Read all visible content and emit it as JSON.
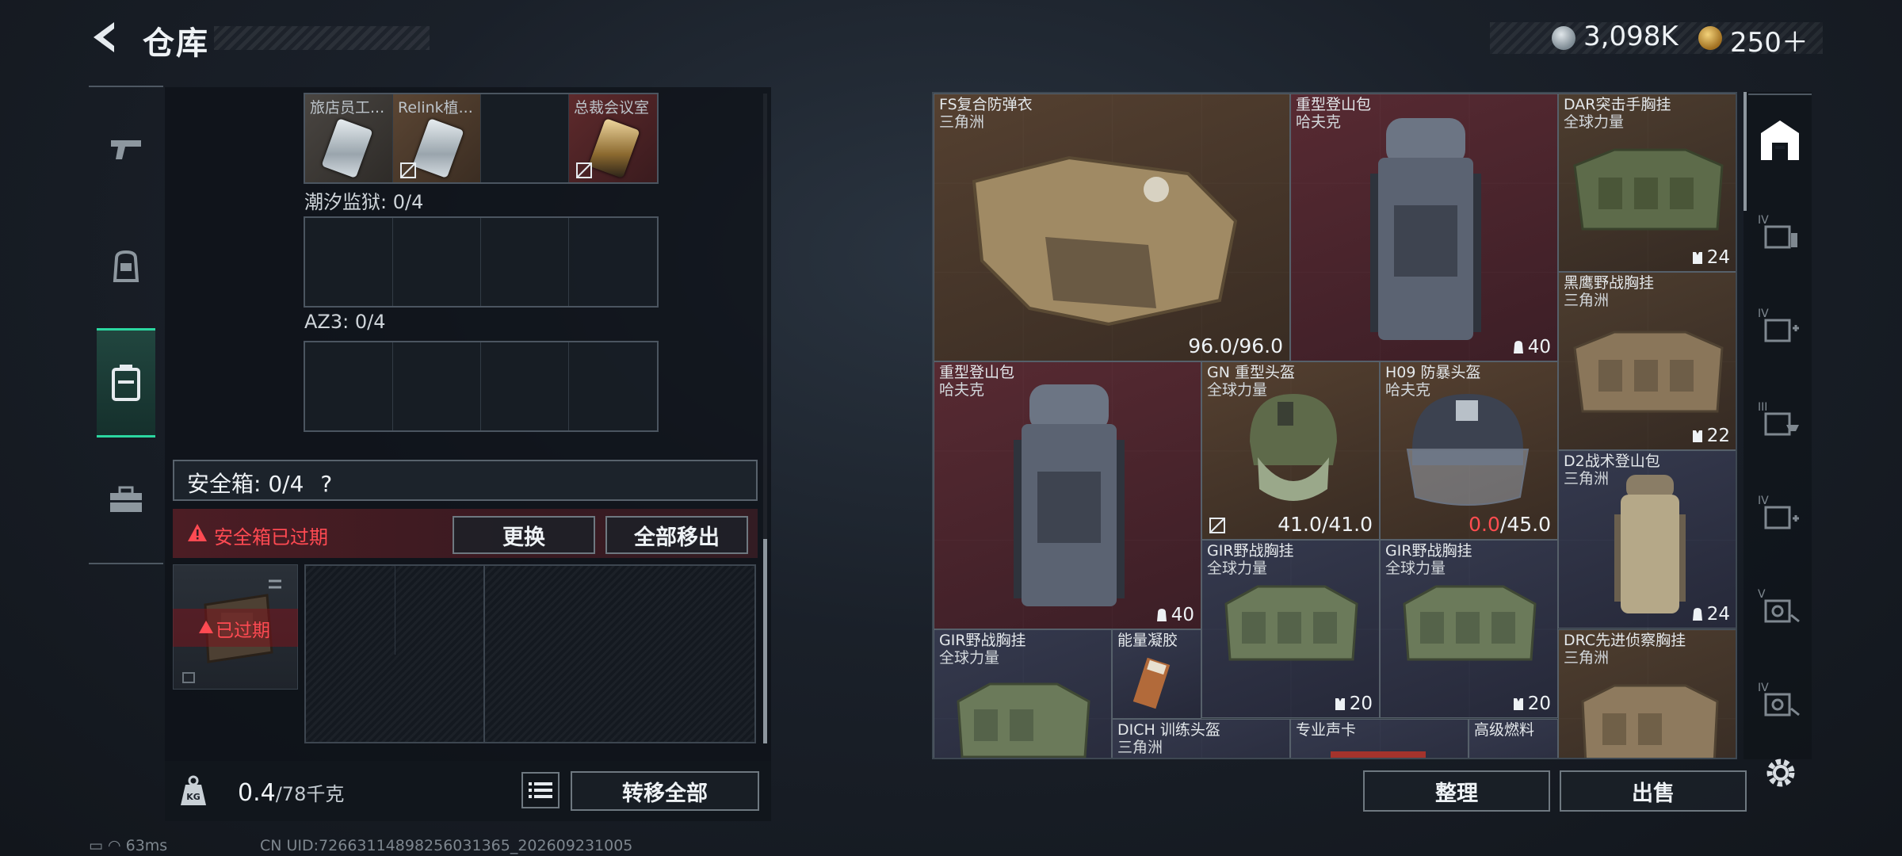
{
  "header": {
    "title": "仓库"
  },
  "currency": {
    "silver": "3,098K",
    "gold": "250＋"
  },
  "nav": [
    "weapon-tab",
    "gear-tab",
    "container-tab",
    "case-tab"
  ],
  "keys_row": [
    {
      "label": "旅店员工...",
      "style": "silver",
      "locked": false
    },
    {
      "label": "Relink植...",
      "style": "silver",
      "locked": true
    },
    {
      "label": "",
      "style": "empty",
      "locked": false
    },
    {
      "label": "总裁会议室",
      "style": "gold",
      "locked": true
    }
  ],
  "sections": [
    {
      "label": "潮汐监狱: 0/4"
    },
    {
      "label": "AZ3: 0/4"
    }
  ],
  "safebox": {
    "label": "安全箱:  0/4",
    "help": "?",
    "warning": "安全箱已过期",
    "swap_btn": "更换",
    "moveall_btn": "全部移出",
    "expired": "已过期"
  },
  "weight": {
    "value": "0.4",
    "unit": "/78千克",
    "transfer_btn": "转移全部"
  },
  "status": {
    "ping": "63ms",
    "uid": "CN UID:7266311489825603136​5_202609231005"
  },
  "stash_items": [
    {
      "name": "FS复合防弹衣",
      "sub": "三角洲",
      "dur": "96.0/96.0",
      "dur_red": ""
    },
    {
      "name": "重型登山包",
      "sub": "哈夫克",
      "count": "40"
    },
    {
      "name": "DAR突击手胸挂",
      "sub": "全球力量",
      "count": "24"
    },
    {
      "name": "黑鹰野战胸挂",
      "sub": "三角洲",
      "count": "22"
    },
    {
      "name": "重型登山包",
      "sub": "哈夫克",
      "count": "40"
    },
    {
      "name": "GN 重型头盔",
      "sub": "全球力量",
      "dur": "41.0/41.0",
      "dur_red": ""
    },
    {
      "name": "H09 防暴头盔",
      "sub": "哈夫克",
      "dur": "/45.0",
      "dur_red": "0.0"
    },
    {
      "name": "D2战术登山包",
      "sub": "三角洲",
      "count": "24"
    },
    {
      "name": "GIR野战胸挂",
      "sub": "全球力量",
      "count": "20"
    },
    {
      "name": "GIR野战胸挂",
      "sub": "全球力量",
      "count": "20"
    },
    {
      "name": "GIR野战胸挂",
      "sub": "全球力量"
    },
    {
      "name": "能量凝胶",
      "sub": ""
    },
    {
      "name": "DRC先进侦察胸挂",
      "sub": "三角洲"
    },
    {
      "name": "DICH 训练头盔",
      "sub": "三角洲"
    },
    {
      "name": "专业声卡",
      "sub": ""
    },
    {
      "name": "高级燃料",
      "sub": ""
    }
  ],
  "stash_buttons": {
    "sort": "整理",
    "sell": "出售"
  },
  "right_tabs": [
    "IV",
    "IV",
    "III",
    "IV",
    "V",
    "IV"
  ],
  "colors": {
    "accent": "#2bd7a0",
    "warning": "#ff4a52"
  }
}
